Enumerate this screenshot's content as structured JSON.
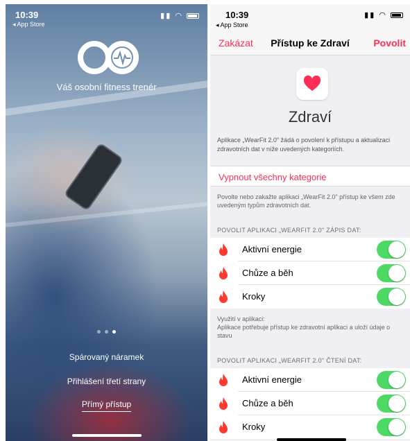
{
  "left": {
    "status_time": "10:39",
    "back_label": "◂ App Store",
    "tagline": "Váš osobní fitness trenér",
    "buttons": {
      "paired": "Spárovaný náramek",
      "third_party": "Přihlášení třetí strany",
      "direct": "Přímý přístup"
    }
  },
  "right": {
    "status_time": "10:39",
    "back_label": "◂ App Store",
    "nav": {
      "cancel": "Zakázat",
      "title": "Přístup ke Zdraví",
      "allow": "Povolit"
    },
    "health_title": "Zdraví",
    "intro": "Aplikace „WearFit 2.0\" žádá o povolení k přístupu a aktualizaci zdravotních dat v níže uvedených kategoriích.",
    "disable_all": "Vypnout všechny kategorie",
    "toggle_note": "Povolte nebo zakažte aplikaci „WearFit 2.0\" přístup ke všem zde uvedeným typům zdravotních dat.",
    "write_header": "POVOLIT APLIKACI „WEARFIT 2.0\" ZÁPIS DAT:",
    "write_rows": [
      {
        "label": "Aktivní energie",
        "on": true
      },
      {
        "label": "Chůze a běh",
        "on": true
      },
      {
        "label": "Kroky",
        "on": true
      }
    ],
    "usage_note": "Využití v aplikaci:\nAplikace potřebuje přístup ke zdravotní aplikaci a uloží údaje o stavu",
    "read_header": "POVOLIT APLIKACI „WEARFIT 2.0\" ČTENÍ DAT:",
    "read_rows": [
      {
        "label": "Aktivní energie",
        "on": true
      },
      {
        "label": "Chůze a běh",
        "on": true
      },
      {
        "label": "Kroky",
        "on": true
      }
    ]
  },
  "colors": {
    "accent": "#ff2d55",
    "toggle_on": "#4cd964",
    "flame": "#ff3b30"
  }
}
